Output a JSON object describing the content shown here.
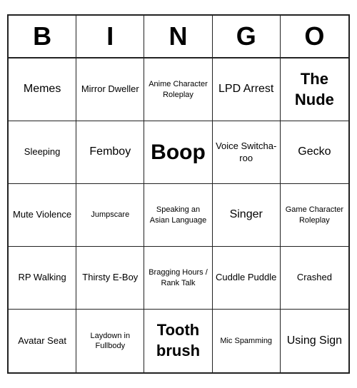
{
  "header": {
    "letters": [
      "B",
      "I",
      "N",
      "G",
      "O"
    ]
  },
  "cells": [
    {
      "text": "Memes",
      "size": "medium"
    },
    {
      "text": "Mirror Dweller",
      "size": "normal"
    },
    {
      "text": "Anime Character Roleplay",
      "size": "small"
    },
    {
      "text": "LPD Arrest",
      "size": "medium"
    },
    {
      "text": "The Nude",
      "size": "large"
    },
    {
      "text": "Sleeping",
      "size": "normal"
    },
    {
      "text": "Femboy",
      "size": "medium"
    },
    {
      "text": "Boop",
      "size": "xlarge"
    },
    {
      "text": "Voice Switcha-roo",
      "size": "normal"
    },
    {
      "text": "Gecko",
      "size": "medium"
    },
    {
      "text": "Mute Violence",
      "size": "normal"
    },
    {
      "text": "Jumpscare",
      "size": "small"
    },
    {
      "text": "Speaking an Asian Language",
      "size": "small"
    },
    {
      "text": "Singer",
      "size": "medium"
    },
    {
      "text": "Game Character Roleplay",
      "size": "small"
    },
    {
      "text": "RP Walking",
      "size": "normal"
    },
    {
      "text": "Thirsty E-Boy",
      "size": "normal"
    },
    {
      "text": "Bragging Hours / Rank Talk",
      "size": "small"
    },
    {
      "text": "Cuddle Puddle",
      "size": "normal"
    },
    {
      "text": "Crashed",
      "size": "normal"
    },
    {
      "text": "Avatar Seat",
      "size": "normal"
    },
    {
      "text": "Laydown in Fullbody",
      "size": "small"
    },
    {
      "text": "Tooth brush",
      "size": "large"
    },
    {
      "text": "Mic Spamming",
      "size": "small"
    },
    {
      "text": "Using Sign",
      "size": "medium"
    }
  ]
}
